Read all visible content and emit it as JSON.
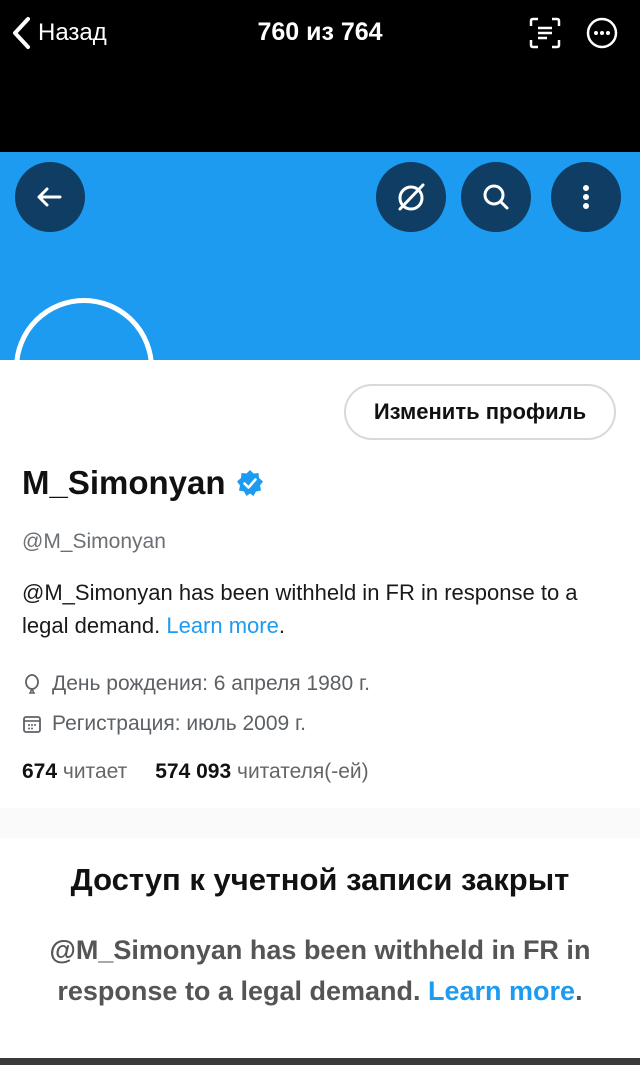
{
  "viewer": {
    "back_label": "Назад",
    "counter": "760 из 764"
  },
  "profile": {
    "edit_button": "Изменить профиль",
    "name": "M_Simonyan",
    "handle": "@M_Simonyan",
    "bio_text": "@M_Simonyan has been withheld in FR in response to a legal demand.",
    "bio_link": "Learn more",
    "bio_period": ".",
    "birthday": "День рождения: 6 апреля 1980 г.",
    "joined": "Регистрация: июль 2009 г.",
    "following_count": "674",
    "following_label": "читает",
    "followers_count": "574 093",
    "followers_label": "читателя(-ей)"
  },
  "withheld": {
    "title": "Доступ к учетной записи закрыт",
    "text": "@M_Simonyan has been withheld in FR in response to a legal demand.",
    "link": "Learn more",
    "period": "."
  },
  "colors": {
    "banner": "#1d9bf0",
    "link": "#1d9bf0",
    "circle_button": "#0f3d63"
  }
}
